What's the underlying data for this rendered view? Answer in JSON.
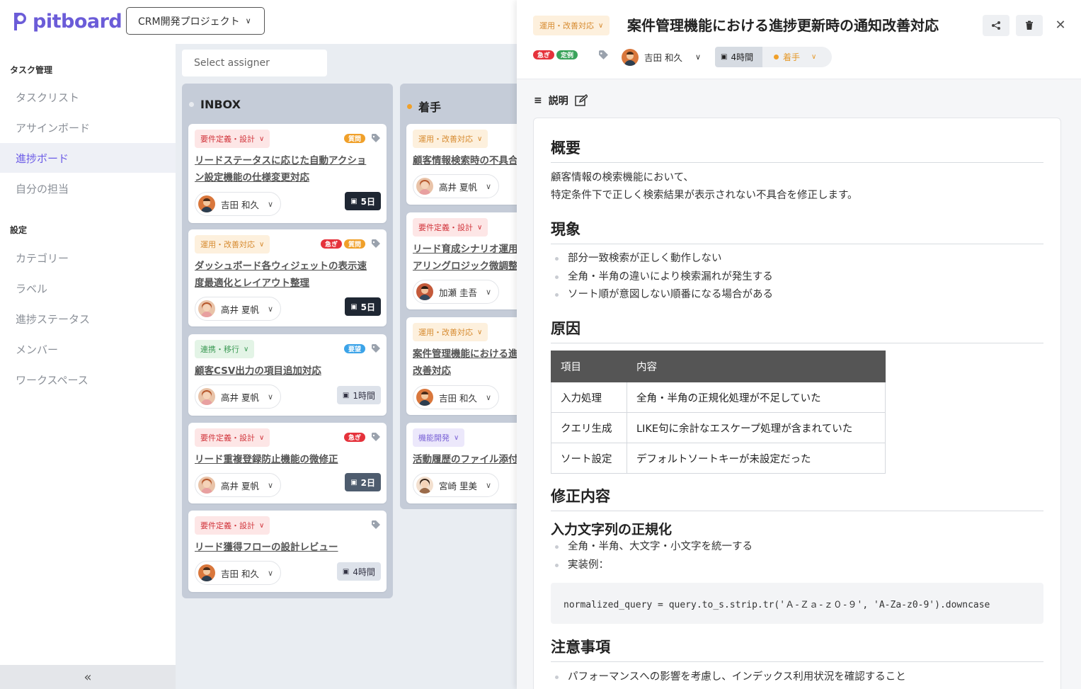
{
  "app": {
    "name": "pitboard",
    "brand_color": "#6b5cd8"
  },
  "project": {
    "selected": "CRM開発プロジェクト"
  },
  "sidebar": {
    "sections": [
      {
        "label": "タスク管理"
      },
      {
        "label": "設定"
      }
    ],
    "task_items": [
      "タスクリスト",
      "アサインボード",
      "進捗ボード",
      "自分の担当"
    ],
    "setting_items": [
      "カテゴリー",
      "ラベル",
      "進捗ステータス",
      "メンバー",
      "ワークスペース"
    ],
    "active": "進捗ボード",
    "collapse_icon": "«"
  },
  "filter": {
    "assignee_placeholder": "Select assigner"
  },
  "board": {
    "columns": [
      {
        "title": "INBOX",
        "dot_color": "#e8ebf0",
        "cards": [
          {
            "category": "要件定義・設計",
            "badges": [
              "質問"
            ],
            "title_lines": [
              "リードステータスに応じた自動アクショ",
              "ン設定機能の仕様変更対応"
            ],
            "owner": "吉田 和久",
            "estimate": "5日"
          },
          {
            "category": "運用・改善対応",
            "badges": [
              "急ぎ",
              "質問"
            ],
            "title_lines": [
              "ダッシュボード各ウィジェットの表示速",
              "度最適化とレイアウト整理"
            ],
            "owner": "高井 夏帆",
            "estimate": "5日"
          },
          {
            "category": "連携・移行",
            "badges": [
              "要望"
            ],
            "title_lines": [
              "顧客CSV出力の項目追加対応"
            ],
            "owner": "高井 夏帆",
            "estimate": "1時間"
          },
          {
            "category": "要件定義・設計",
            "badges": [
              "急ぎ"
            ],
            "title_lines": [
              "リード重複登録防止機能の微修正"
            ],
            "owner": "高井 夏帆",
            "estimate": "2日"
          },
          {
            "category": "要件定義・設計",
            "badges": [],
            "title_lines": [
              "リード獲得フローの設計レビュー"
            ],
            "owner": "吉田 和久",
            "estimate": "4時間"
          }
        ]
      },
      {
        "title": "着手",
        "dot_color": "#f0a02a",
        "cards": [
          {
            "category": "運用・改善対応",
            "title_lines": [
              "顧客情報検索時の不具合"
            ],
            "owner": "高井 夏帆"
          },
          {
            "category": "要件定義・設計",
            "title_lines": [
              "リード育成シナリオ運用",
              "アリングロジック微調整"
            ],
            "owner": "加瀬 圭吾"
          },
          {
            "category": "運用・改善対応",
            "title_lines": [
              "案件管理機能における進",
              "改善対応"
            ],
            "owner": "吉田 和久"
          },
          {
            "category": "機能開発",
            "title_lines": [
              "活動履歴のファイル添付"
            ],
            "owner": "宮崎 里美"
          }
        ]
      }
    ]
  },
  "detail": {
    "category": "運用・改善対応",
    "title": "案件管理機能における進捗更新時の通知改善対応",
    "badges": [
      "急ぎ",
      "定例"
    ],
    "owner": "吉田 和久",
    "estimate": "4時間",
    "status": "着手",
    "section_label": "説明",
    "doc": {
      "h_overview": "概要",
      "overview_lines": [
        "顧客情報の検索機能において、",
        "特定条件下で正しく検索結果が表示されない不具合を修正します。"
      ],
      "h_symptom": "現象",
      "symptoms": [
        "部分一致検索が正しく動作しない",
        "全角・半角の違いにより検索漏れが発生する",
        "ソート順が意図しない順番になる場合がある"
      ],
      "h_cause": "原因",
      "table": {
        "headers": [
          "項目",
          "内容"
        ],
        "rows": [
          [
            "入力処理",
            "全角・半角の正規化処理が不足していた"
          ],
          [
            "クエリ生成",
            "LIKE句に余計なエスケープ処理が含まれていた"
          ],
          [
            "ソート設定",
            "デフォルトソートキーが未設定だった"
          ]
        ]
      },
      "h_fix": "修正内容",
      "h_normalize": "入力文字列の正規化",
      "fix_items": [
        "全角・半角、大文字・小文字を統一する",
        "実装例："
      ],
      "code": "normalized_query = query.to_s.strip.tr('Ａ-Ｚａ-ｚ０-９', 'A-Za-z0-9').downcase",
      "h_notes": "注意事項",
      "notes": [
        "パフォーマンスへの影響を考慮し、インデックス利用状況を確認すること"
      ]
    }
  },
  "colors": {
    "badge_urgent": "#e5323b",
    "badge_question": "#f0a02a",
    "badge_request": "#3ba3e8",
    "badge_regular": "#3aa35b"
  }
}
